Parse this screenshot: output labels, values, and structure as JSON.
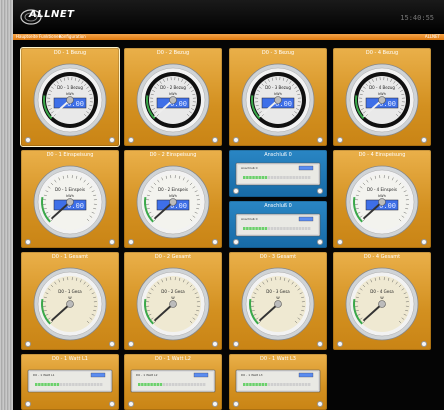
{
  "header": {
    "brand": "ALLNET",
    "clock": "15:40:55"
  },
  "nav": {
    "items": [
      "Hauptseite",
      "Funktionen",
      "Konfiguration"
    ],
    "right": "ALLNET"
  },
  "tiles": [
    {
      "title": "D0 - 1 Bezug",
      "kind": "black",
      "label": "D0 - 1 Bezug",
      "unit": "kWh",
      "value": "0.00",
      "selected": true
    },
    {
      "title": "D0 - 2 Bezug",
      "kind": "black",
      "label": "D0 - 2 Bezug",
      "unit": "kWh",
      "value": "0.00"
    },
    {
      "title": "D0 - 3 Bezug",
      "kind": "black",
      "label": "D0 - 3 Bezug",
      "unit": "kWh",
      "value": "0.00"
    },
    {
      "title": "D0 - 4 Bezug",
      "kind": "black",
      "label": "D0 - 4 Bezug",
      "unit": "kWh",
      "value": "0.00"
    },
    {
      "title": "D0 - 1 Einspeisung",
      "kind": "white",
      "label": "D0 - 1 Einspeis",
      "unit": "kWh",
      "value": "0.00"
    },
    {
      "title": "D0 - 2 Einspeisung",
      "kind": "white",
      "label": "D0 - 2 Einspeis",
      "unit": "kWh",
      "value": "0.00"
    },
    {
      "title": "Anschluß 0",
      "kind": "strip",
      "label": "Anschluß 0"
    },
    {
      "title": "D0 - 4 Einspeisung",
      "kind": "white",
      "label": "D0 - 4 Einspeis",
      "unit": "kWh",
      "value": "0.00"
    },
    {
      "title": "Anschluß 0",
      "kind": "strip",
      "label": "Anschluß 0"
    },
    {
      "title": "D0 - 1 Gesamt",
      "kind": "cream",
      "label": "D0 - 1 Gesa",
      "unit": "W"
    },
    {
      "title": "D0 - 2 Gesamt",
      "kind": "cream",
      "label": "D0 - 2 Gesa",
      "unit": "W"
    },
    {
      "title": "D0 - 3 Gesamt",
      "kind": "cream",
      "label": "D0 - 3 Gesa",
      "unit": "W"
    },
    {
      "title": "D0 - 4 Gesamt",
      "kind": "cream",
      "label": "D0 - 4 Gesa",
      "unit": "W"
    },
    {
      "title": "D0 - 1 Watt L1",
      "kind": "strip",
      "label": "D0 - 1 Watt L1"
    },
    {
      "title": "D0 - 1 Watt L2",
      "kind": "strip",
      "label": "D0 - 1 Watt L2"
    },
    {
      "title": "D0 - 1 Watt L3",
      "kind": "strip",
      "label": "D0 - 1 Watt L3"
    }
  ]
}
